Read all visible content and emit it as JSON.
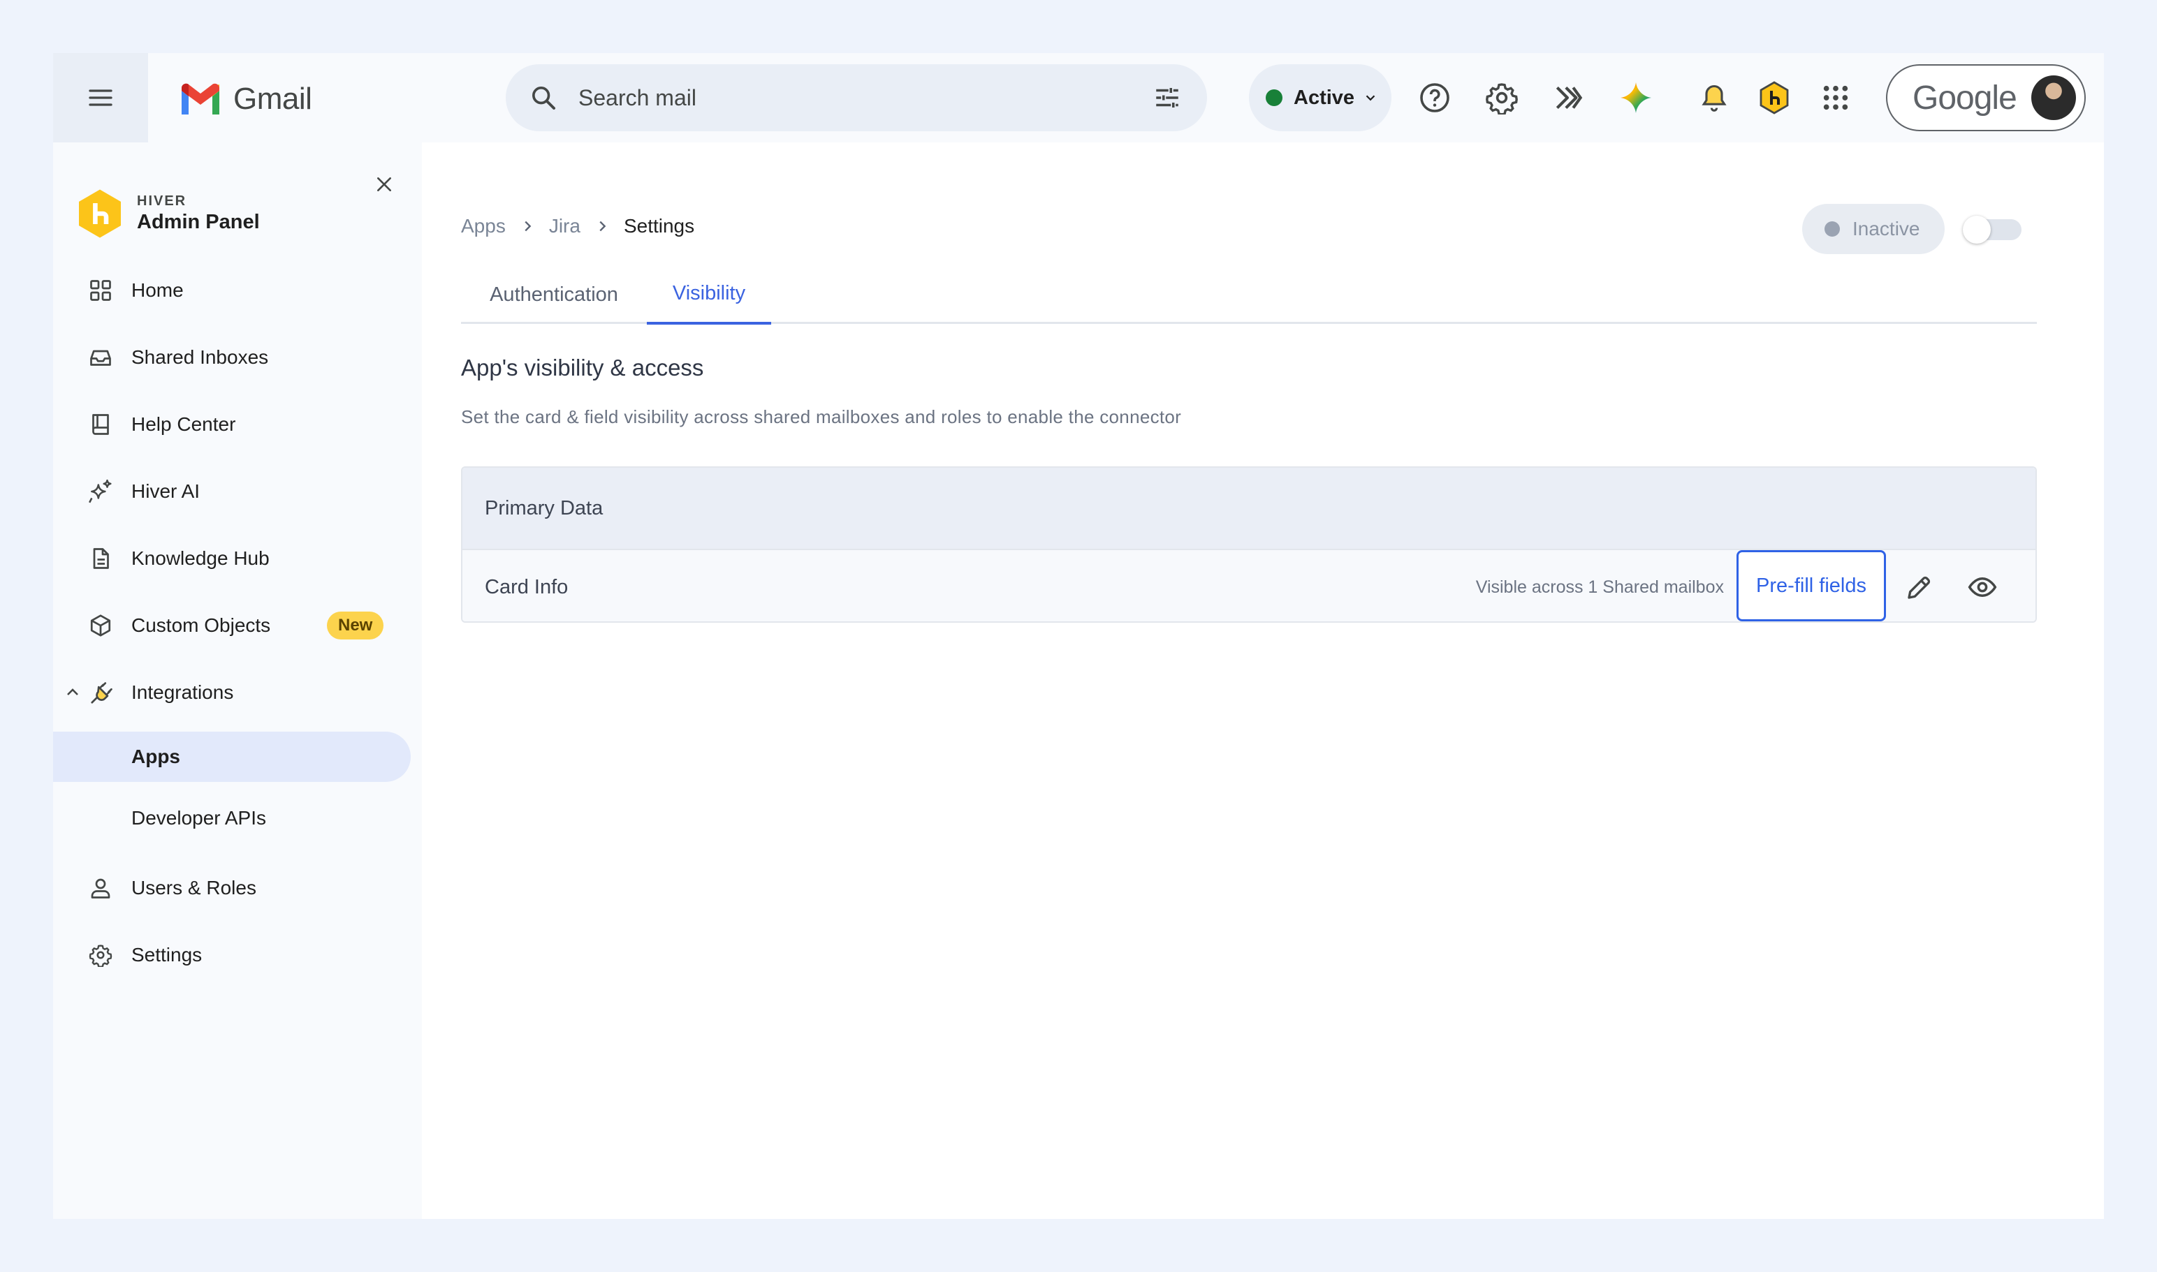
{
  "topbar": {
    "app_name": "Gmail",
    "search_placeholder": "Search mail",
    "status_label": "Active",
    "status_color": "#188038",
    "account_brand": "Google",
    "icons": [
      "menu-icon",
      "gmail-logo-icon",
      "search-icon",
      "tune-icon",
      "help-icon",
      "settings-gear-icon",
      "hiver-chevrons-icon",
      "gemini-sparkle-icon",
      "notification-bell-icon",
      "hiver-hex-icon",
      "apps-grid-icon"
    ]
  },
  "sidebar": {
    "brand_small": "HIVER",
    "brand_title": "Admin Panel",
    "items": [
      {
        "label": "Home",
        "icon": "grid-icon"
      },
      {
        "label": "Shared Inboxes",
        "icon": "inbox-icon"
      },
      {
        "label": "Help Center",
        "icon": "book-icon"
      },
      {
        "label": "Hiver AI",
        "icon": "sparkle-icon"
      },
      {
        "label": "Knowledge Hub",
        "icon": "document-icon"
      },
      {
        "label": "Custom Objects",
        "icon": "cube-icon",
        "badge": "New"
      },
      {
        "label": "Integrations",
        "icon": "plug-icon"
      },
      {
        "label": "Apps",
        "active": true
      },
      {
        "label": "Developer APIs"
      },
      {
        "label": "Users & Roles",
        "icon": "user-icon"
      },
      {
        "label": "Settings",
        "icon": "gear-icon"
      }
    ]
  },
  "main": {
    "breadcrumb": [
      "Apps",
      "Jira",
      "Settings"
    ],
    "status_label": "Inactive",
    "toggle_on": false,
    "tabs": [
      {
        "label": "Authentication",
        "active": false
      },
      {
        "label": "Visibility",
        "active": true
      }
    ],
    "section_title": "App's visibility & access",
    "section_subtitle": "Set the card & field visibility across shared mailboxes and roles to enable the connector",
    "table": {
      "header": "Primary Data",
      "rows": [
        {
          "name": "Card Info",
          "visibility": "Visible across 1 Shared mailbox",
          "action_label": "Pre-fill fields"
        }
      ]
    },
    "accent_color": "#2f62e6"
  }
}
